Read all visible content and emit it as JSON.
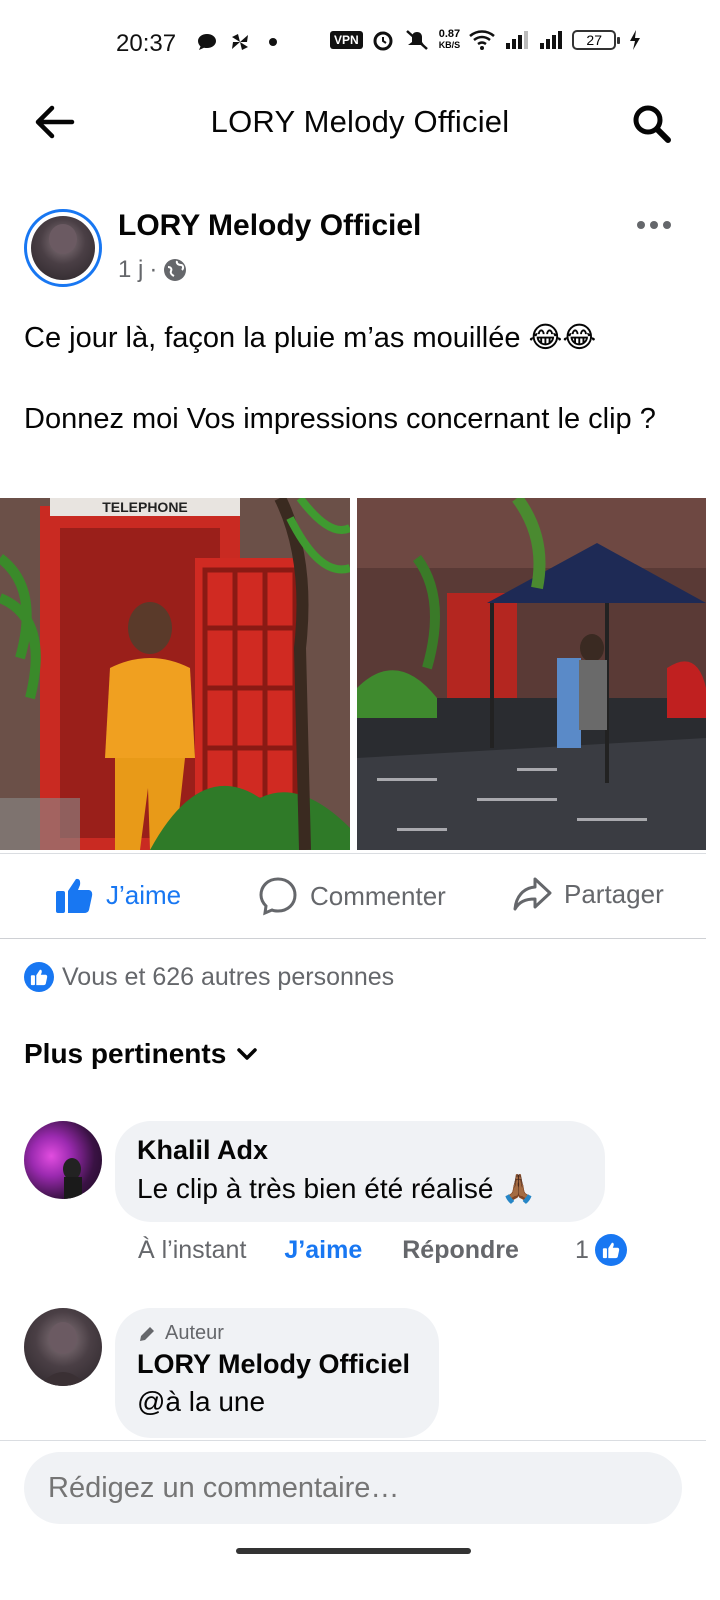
{
  "status_bar": {
    "time": "20:37",
    "vpn_label": "VPN",
    "net_speed_value": "0.87",
    "net_speed_unit": "KB/S",
    "battery_level": "27",
    "icons": [
      "chat-bubble-icon",
      "pinwheel-icon",
      "dot-icon",
      "alarm-icon",
      "mute-icon",
      "wifi-icon",
      "signal-icon",
      "signal-icon",
      "battery-icon",
      "charging-icon"
    ]
  },
  "header": {
    "title": "LORY Melody Officiel",
    "back_icon": "arrow-left-icon",
    "search_icon": "search-icon"
  },
  "post": {
    "author": "LORY Melody Officiel",
    "time": "1 j",
    "separator": "·",
    "privacy_icon": "globe-icon",
    "text_line1": "Ce jour là, façon la pluie m’as mouillée 😂😂",
    "text_line2": "Donnez moi Vos impressions concernant le clip ?",
    "photo_caption_sign": "TELEPHONE"
  },
  "actions": {
    "like_label": "J’aime",
    "comment_label": "Commenter",
    "share_label": "Partager"
  },
  "reactions": {
    "summary": "Vous et 626 autres personnes"
  },
  "sort": {
    "label": "Plus pertinents"
  },
  "comments": [
    {
      "name": "Khalil Adx",
      "text": "Le clip à très bien été réalisé 🙏🏾",
      "time": "À l’instant",
      "like_label": "J’aime",
      "reply_label": "Répondre",
      "like_count": "1"
    },
    {
      "author_tag": "Auteur",
      "name": "LORY Melody Officiel",
      "text": "@à la une"
    }
  ],
  "composer": {
    "placeholder": "Rédigez un commentaire…"
  },
  "colors": {
    "accent": "#1877f2",
    "secondary_text": "#65676b",
    "bubble_bg": "#f0f2f5"
  }
}
